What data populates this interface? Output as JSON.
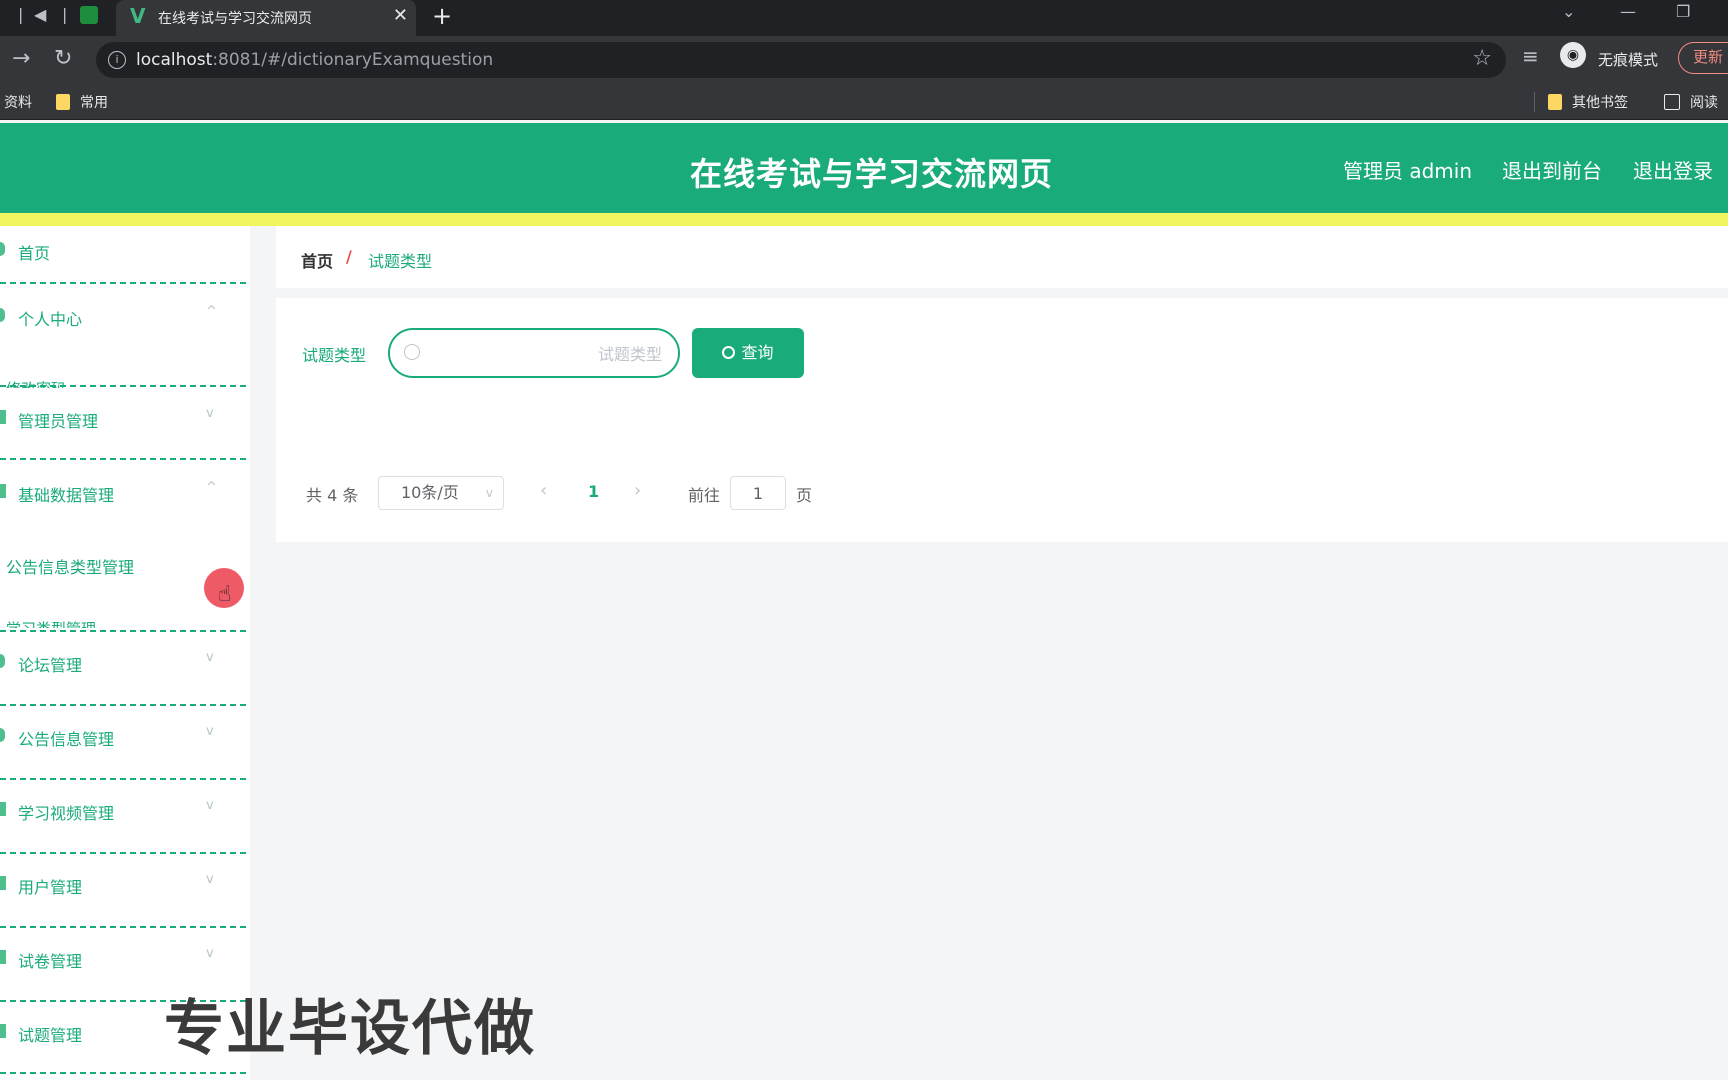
{
  "browser": {
    "tab_title": "在线考试与学习交流网页",
    "url_host": "localhost",
    "url_path": ":8081/#/dictionaryExamquestion",
    "incognito_label": "无痕模式",
    "update_label": "更新",
    "bookmarks": {
      "left_partial": "资料",
      "common": "常用",
      "other": "其他书签",
      "reader_partial": "阅读"
    }
  },
  "header": {
    "title": "在线考试与学习交流网页",
    "user_label": "管理员 admin",
    "to_front": "退出到前台",
    "logout": "退出登录"
  },
  "sidebar": {
    "items": [
      {
        "label": "首页"
      },
      {
        "label": "个人中心"
      },
      {
        "label": "管理员管理"
      },
      {
        "label": "基础数据管理"
      },
      {
        "label": "论坛管理"
      },
      {
        "label": "公告信息管理"
      },
      {
        "label": "学习视频管理"
      },
      {
        "label": "用户管理"
      },
      {
        "label": "试卷管理"
      },
      {
        "label": "试题管理"
      }
    ],
    "sub_items": [
      {
        "label": "公告信息类型管理"
      }
    ],
    "cut_labels": {
      "under_personal": "修改密码",
      "under_notice_type": "学习类型管理"
    }
  },
  "breadcrumb": {
    "home": "首页",
    "separator": "/",
    "current": "试题类型"
  },
  "search": {
    "label": "试题类型",
    "placeholder": "试题类型",
    "value": "",
    "button_label": "查询"
  },
  "pagination": {
    "total": "共 4 条",
    "page_size": "10条/页",
    "current_page": "1",
    "goto_label": "前往",
    "goto_value": "1",
    "page_suffix": "页"
  },
  "overlay": {
    "watermark_text": "专业毕设代做"
  },
  "colors": {
    "primary": "#1aab7a",
    "accent_stripe": "#f0f560",
    "breadcrumb_sep": "#e05252"
  }
}
